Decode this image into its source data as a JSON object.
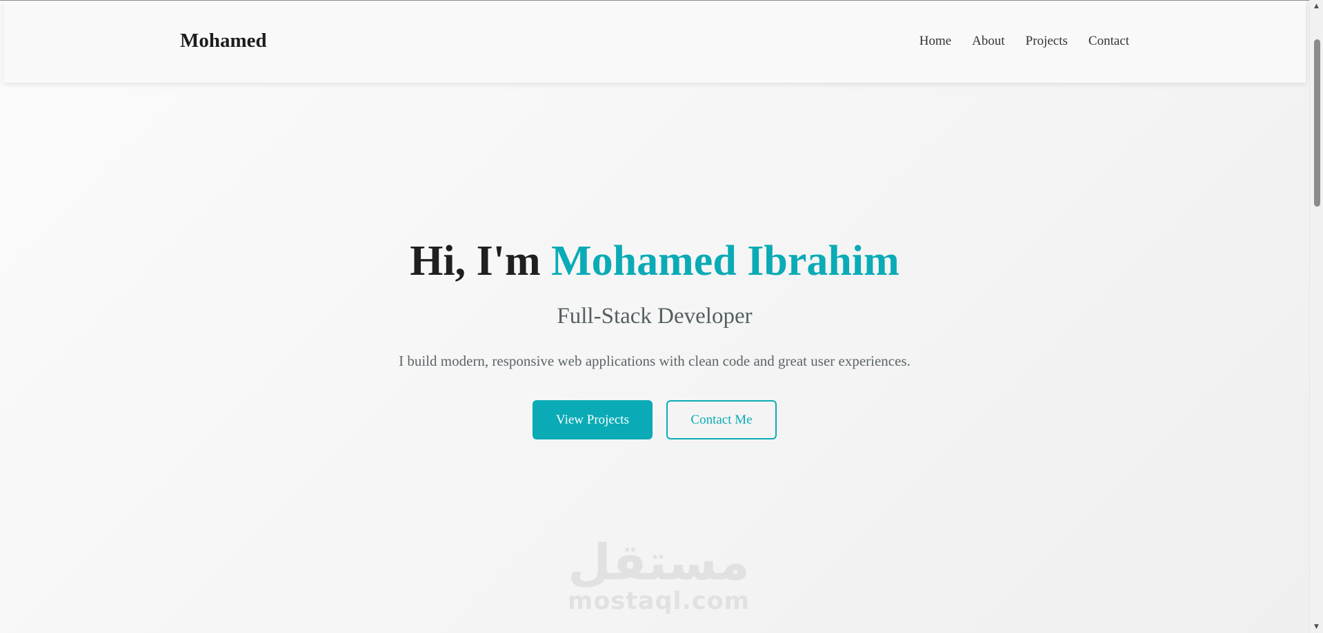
{
  "navbar": {
    "brand": "Mohamed",
    "links": [
      "Home",
      "About",
      "Projects",
      "Contact"
    ]
  },
  "hero": {
    "greeting": "Hi, I'm ",
    "name": "Mohamed Ibrahim",
    "subtitle": "Full-Stack Developer",
    "tagline": "I build modern, responsive web applications with clean code and great user experiences.",
    "primary_button": "View Projects",
    "secondary_button": "Contact Me"
  },
  "watermark": {
    "arabic": "مستقل",
    "latin": "mostaql.com"
  },
  "colors": {
    "accent": "#0aabb6",
    "text_dark": "#1f1f1f",
    "text_muted": "#555f61"
  },
  "icons": {
    "scroll_up": "scroll-up-arrow-icon",
    "scroll_down": "scroll-down-arrow-icon"
  }
}
